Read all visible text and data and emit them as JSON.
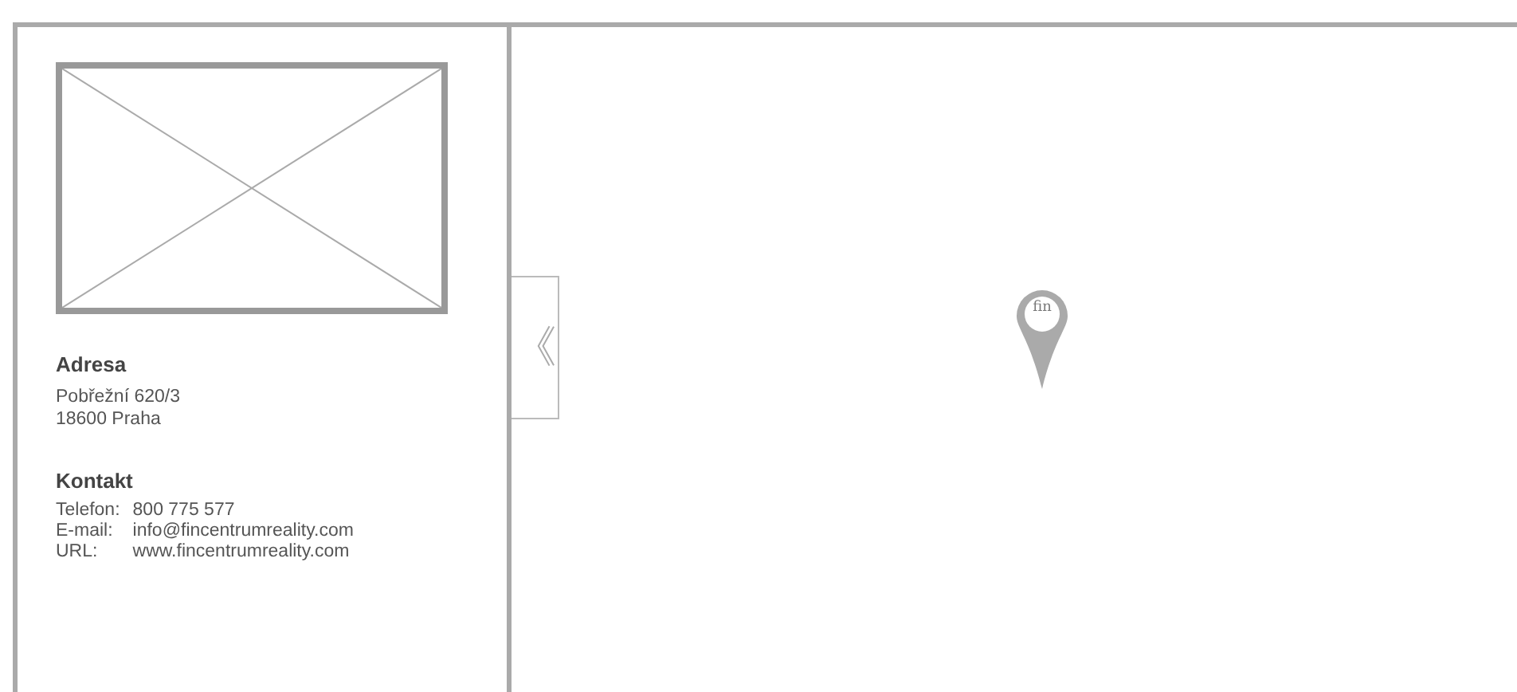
{
  "address": {
    "heading": "Adresa",
    "lines": [
      "Pobřežní 620/3",
      "18600 Praha"
    ]
  },
  "contact": {
    "heading": "Kontakt",
    "rows": [
      {
        "label": "Telefon:",
        "value": "800 775 577"
      },
      {
        "label": "E-mail:",
        "value": "info@fincentrumreality.com"
      },
      {
        "label": "URL:",
        "value": "www.fincentrumreality.com"
      }
    ]
  },
  "collapse_button": {
    "glyph": "《"
  },
  "map": {
    "pin": {
      "label": "fin"
    }
  }
}
